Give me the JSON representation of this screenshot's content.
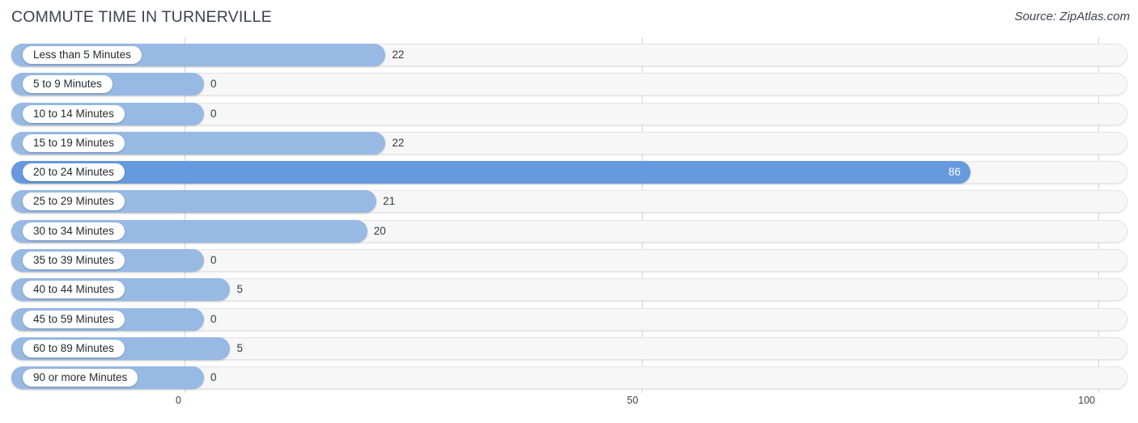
{
  "header": {
    "title": "COMMUTE TIME IN TURNERVILLE",
    "source": "Source: ZipAtlas.com"
  },
  "colors": {
    "bar": "#97b9e3",
    "bar_highlight": "#6699dd",
    "track": "#f7f7f7",
    "gridline": "#d6d6d6",
    "text": "#3b4450"
  },
  "chart_data": {
    "type": "bar",
    "orientation": "horizontal",
    "title": "COMMUTE TIME IN TURNERVILLE",
    "xlabel": "",
    "ylabel": "",
    "xlim": [
      0,
      100
    ],
    "ticks": [
      0,
      50,
      100
    ],
    "tick_labels": [
      "0",
      "50",
      "100"
    ],
    "grid": true,
    "legend": false,
    "highlight_category": "20 to 24 Minutes",
    "categories": [
      "Less than 5 Minutes",
      "5 to 9 Minutes",
      "10 to 14 Minutes",
      "15 to 19 Minutes",
      "20 to 24 Minutes",
      "25 to 29 Minutes",
      "30 to 34 Minutes",
      "35 to 39 Minutes",
      "40 to 44 Minutes",
      "45 to 59 Minutes",
      "60 to 89 Minutes",
      "90 or more Minutes"
    ],
    "values": [
      22,
      0,
      0,
      22,
      86,
      21,
      20,
      0,
      5,
      0,
      5,
      0
    ],
    "value_labels": [
      "22",
      "0",
      "0",
      "22",
      "86",
      "21",
      "20",
      "0",
      "5",
      "0",
      "5",
      "0"
    ],
    "rows": [
      {
        "label": "Less than 5 Minutes",
        "value": 22,
        "value_label": "22",
        "highlight": false
      },
      {
        "label": "5 to 9 Minutes",
        "value": 0,
        "value_label": "0",
        "highlight": false
      },
      {
        "label": "10 to 14 Minutes",
        "value": 0,
        "value_label": "0",
        "highlight": false
      },
      {
        "label": "15 to 19 Minutes",
        "value": 22,
        "value_label": "22",
        "highlight": false
      },
      {
        "label": "20 to 24 Minutes",
        "value": 86,
        "value_label": "86",
        "highlight": true
      },
      {
        "label": "25 to 29 Minutes",
        "value": 21,
        "value_label": "21",
        "highlight": false
      },
      {
        "label": "30 to 34 Minutes",
        "value": 20,
        "value_label": "20",
        "highlight": false
      },
      {
        "label": "35 to 39 Minutes",
        "value": 0,
        "value_label": "0",
        "highlight": false
      },
      {
        "label": "40 to 44 Minutes",
        "value": 5,
        "value_label": "5",
        "highlight": false
      },
      {
        "label": "45 to 59 Minutes",
        "value": 0,
        "value_label": "0",
        "highlight": false
      },
      {
        "label": "60 to 89 Minutes",
        "value": 5,
        "value_label": "5",
        "highlight": false
      },
      {
        "label": "90 or more Minutes",
        "value": 0,
        "value_label": "0",
        "highlight": false
      }
    ]
  }
}
